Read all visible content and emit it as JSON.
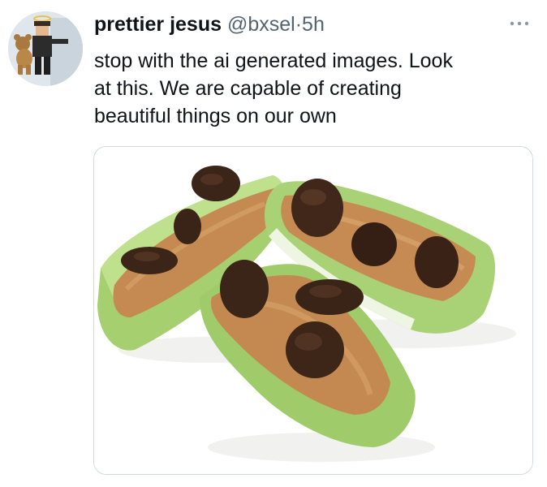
{
  "tweet": {
    "display_name": "prettier jesus",
    "handle": "@bxsel",
    "separator": "·",
    "time": "5h",
    "text_lines": [
      "stop with the ai generated images. Look",
      "at this. We are capable of creating",
      "beautiful things on our own"
    ],
    "avatar_icon": "avatar-figure-icon",
    "more_icon": "more-options-icon",
    "media_description": "celery-peanut-butter-raisins-photo"
  },
  "colors": {
    "text": "#0f1419",
    "secondary": "#536471",
    "border": "#cfd9de",
    "celery": "#9bcb6b",
    "peanut_butter": "#c8915c",
    "raisin": "#3b2418"
  }
}
